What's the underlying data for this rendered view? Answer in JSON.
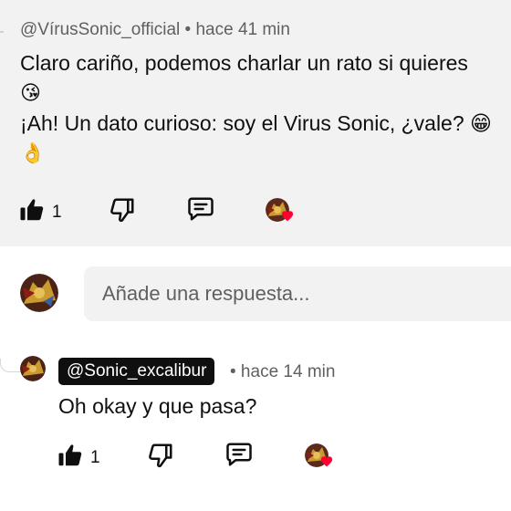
{
  "comment": {
    "author": "@VírusSonic_official",
    "time": "• hace 41 min",
    "line1": "Claro cariño, podemos charlar un rato si quieres",
    "emoji1": "😘",
    "line2": "¡Ah! Un dato curioso: soy el Virus Sonic, ¿vale?",
    "emoji2": "😁",
    "emoji3": "👌",
    "like_count": "1"
  },
  "reply_box": {
    "placeholder": "Añade una respuesta..."
  },
  "reply": {
    "author": "@Sonic_excalibur",
    "time": "• hace 14 min",
    "text": "Oh okay y que pasa?",
    "like_count": "1"
  },
  "icons": {
    "like": "thumbs-up-icon",
    "dislike": "thumbs-down-icon",
    "reply": "comment-icon",
    "creator_heart": "creator-heart-icon"
  },
  "colors": {
    "heart": "#ff0033",
    "highlight_bg": "#f2f2f2",
    "secondary_text": "#606060",
    "badge_bg": "#0f0f0f"
  }
}
